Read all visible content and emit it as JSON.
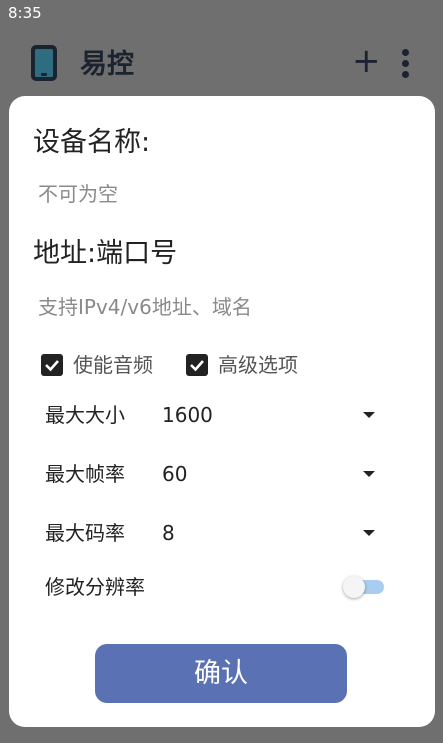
{
  "status_bar": {
    "time": "8:35"
  },
  "app_bar": {
    "title": "易控",
    "add_label": "+"
  },
  "dialog": {
    "device_name_label": "设备名称:",
    "device_name_placeholder": "不可为空",
    "address_label": "地址:端口号",
    "address_placeholder": "支持IPv4/v6地址、域名",
    "checkboxes": [
      {
        "label": "使能音频",
        "checked": true
      },
      {
        "label": "高级选项",
        "checked": true
      }
    ],
    "settings": [
      {
        "label": "最大大小",
        "value": "1600"
      },
      {
        "label": "最大帧率",
        "value": "60"
      },
      {
        "label": "最大码率",
        "value": "8"
      }
    ],
    "resolution_toggle": {
      "label": "修改分辨率",
      "on": false
    },
    "confirm_label": "确认"
  },
  "colors": {
    "scrim": "#6f6f6f",
    "dialog_bg": "#ffffff",
    "confirm_button": "#5a72b3",
    "toggle_track": "#a9cdf0",
    "hint_text": "#8a8a8a"
  }
}
